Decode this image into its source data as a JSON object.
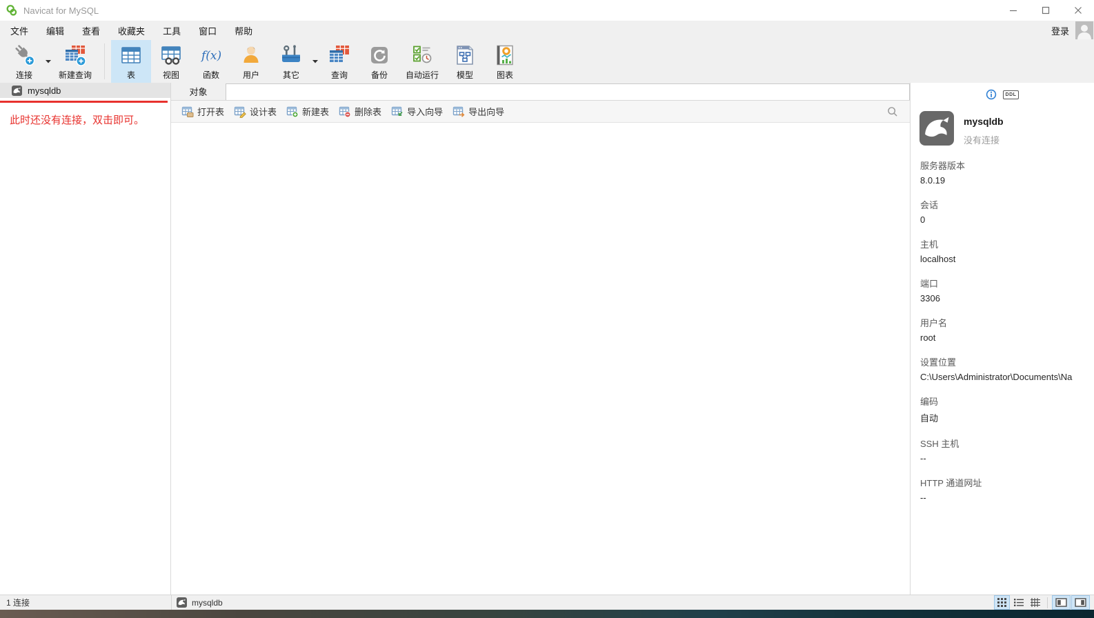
{
  "app": {
    "title": "Navicat for MySQL"
  },
  "menubar": {
    "items": [
      "文件",
      "编辑",
      "查看",
      "收藏夹",
      "工具",
      "窗口",
      "帮助"
    ],
    "login_label": "登录"
  },
  "toolbar": {
    "fx_glyph": "f(x)",
    "buttons": [
      {
        "label": "连接"
      },
      {
        "label": "新建查询"
      },
      {
        "label": "表"
      },
      {
        "label": "视图"
      },
      {
        "label": "函数"
      },
      {
        "label": "用户"
      },
      {
        "label": "其它"
      },
      {
        "label": "查询"
      },
      {
        "label": "备份"
      },
      {
        "label": "自动运行"
      },
      {
        "label": "模型"
      },
      {
        "label": "图表"
      }
    ]
  },
  "sidebar": {
    "connection_name": "mysqldb",
    "annotation": "此时还没有连接，双击即可。"
  },
  "main": {
    "tab_label": "对象",
    "actions": [
      "打开表",
      "设计表",
      "新建表",
      "删除表",
      "导入向导",
      "导出向导"
    ]
  },
  "right_panel": {
    "ddl_label": "DDL",
    "name": "mysqldb",
    "status": "没有连接",
    "fields": [
      {
        "label": "服务器版本",
        "value": "8.0.19"
      },
      {
        "label": "会话",
        "value": "0"
      },
      {
        "label": "主机",
        "value": "localhost"
      },
      {
        "label": "端口",
        "value": "3306"
      },
      {
        "label": "用户名",
        "value": "root"
      },
      {
        "label": "设置位置",
        "value": "C:\\Users\\Administrator\\Documents\\Na"
      },
      {
        "label": "编码",
        "value": "自动"
      },
      {
        "label": "SSH 主机",
        "value": "--"
      },
      {
        "label": "HTTP 通道网址",
        "value": "--"
      }
    ]
  },
  "statusbar": {
    "left_text": "1 连接",
    "active_connection": "mysqldb"
  },
  "colors": {
    "selection_blue": "#cde6f7",
    "annotation_red": "#e8322e",
    "info_blue": "#2f80d4"
  }
}
